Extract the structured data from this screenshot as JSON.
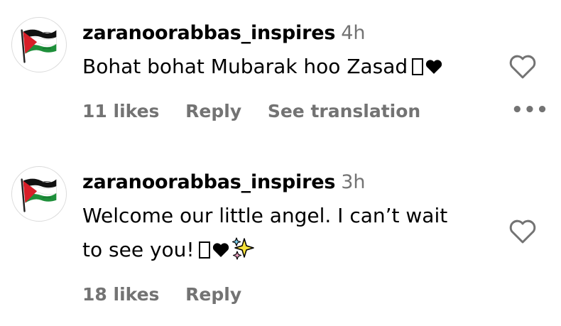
{
  "comments": [
    {
      "username": "zaranoorabbas_inspires",
      "time": "4h",
      "text": "Bohat bohat Mubarak hoo Zasad",
      "likes": "11 likes",
      "reply": "Reply",
      "translation": "See translation",
      "more": "•••"
    },
    {
      "username": "zaranoorabbas_inspires",
      "time": "3h",
      "text_line1": "Welcome our little angel. I can’t wait",
      "text_line2": "to see you!",
      "likes": "18 likes",
      "reply": "Reply"
    }
  ],
  "icons": {
    "avatar": "palestine-flag-avatar",
    "like": "heart-outline-icon",
    "inline_heart": "black-heart-emoji",
    "sparkles": "sparkles-emoji"
  },
  "colors": {
    "text": "#000000",
    "secondary": "#737373",
    "avatar_border": "#dbdbdb"
  }
}
